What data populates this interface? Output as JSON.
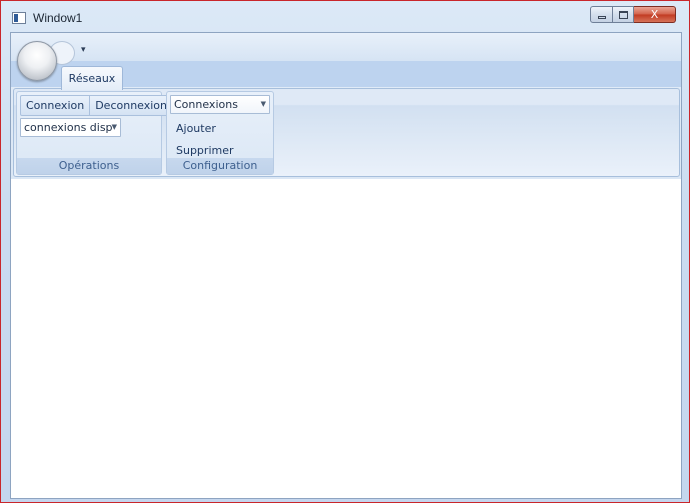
{
  "window": {
    "title": "Window1",
    "controls": {
      "minimize": "minimize",
      "maximize": "maximize",
      "close": "X"
    }
  },
  "ribbon": {
    "qat_dropdown": "▾",
    "tabs": [
      {
        "label": "Réseaux",
        "selected": true
      }
    ],
    "groups": {
      "operations": {
        "title": "Opérations",
        "connexion_label": "Connexion",
        "deconnexion_label": "Deconnexion",
        "dispositif_combo_value": "connexions disp"
      },
      "configuration": {
        "title": "Configuration",
        "connexions_combo_value": "Connexions",
        "ajouter_label": "Ajouter",
        "supprimer_label": "Supprimer"
      }
    }
  },
  "colors": {
    "window_border": "#c9262b",
    "ribbon_background": "#dbe7f5",
    "tab_strip": "#bdd3ef",
    "text_accent": "#1f3a63"
  },
  "icons": {
    "app_icon": "window-icon",
    "combo_arrow": "chevron-down-icon"
  }
}
